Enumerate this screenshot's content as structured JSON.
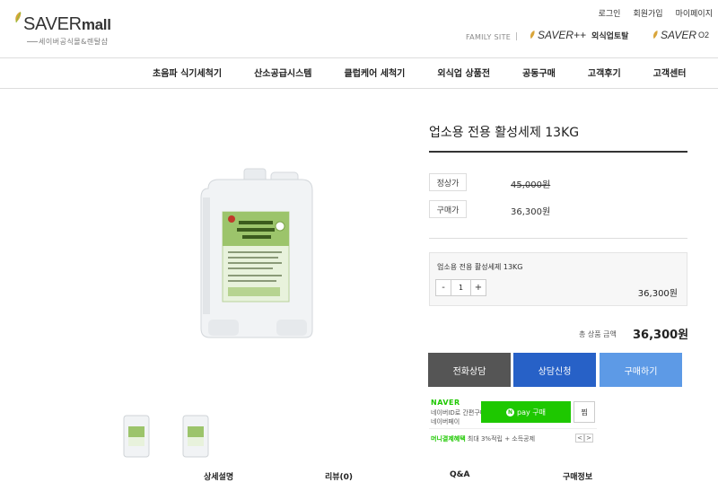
{
  "brand": {
    "logo_text": "SAVER",
    "logo_mall": "mall",
    "subtitle": "세이버공식몰&렌탈샵",
    "leaf_color": "#d9a53a",
    "leaf_color_2": "#8bbf3a"
  },
  "top_links": [
    "로그인",
    "회원가입",
    "마이페이지"
  ],
  "family": {
    "label": "FAMILY SITE",
    "separator": "|",
    "site1_name": "SAVER++",
    "site1_tag": "외식업토탈",
    "site2_name": "SAVER",
    "site2_tag": "O2"
  },
  "nav": [
    "초음파 식기세척기",
    "산소공급시스템",
    "클럽케어 세척기",
    "외식업 상품전",
    "공동구매",
    "고객후기",
    "고객센터"
  ],
  "product": {
    "title": "업소용 전용 활성세제 13KG",
    "list_price_label": "정상가",
    "list_price": "45,000원",
    "sale_price_label": "구매가",
    "sale_price": "36,300원",
    "option_name": "업소용 전용 활성세제 13KG",
    "qty_minus": "-",
    "qty_value": "1",
    "qty_plus": "+",
    "option_price": "36,300원",
    "total_label": "총 상품 금액",
    "total_price": "36,300원",
    "thumbnail_count": 2
  },
  "buttons": {
    "phone": "전화상담",
    "consult": "상담신청",
    "buy": "구매하기",
    "phone_color": "#555555",
    "consult_color": "#2761c7",
    "buy_color": "#5d9ae6"
  },
  "naverpay": {
    "logo": "NAVER",
    "line1": "네이버ID로 간편구매",
    "line2": "네이버페이",
    "pay_badge": "N",
    "pay_label": "pay 구매",
    "zzim": "찜",
    "benefit_label": "머니결제혜택",
    "benefit_text": "최대 3%적립 + 소득공제",
    "prev": "<",
    "next": ">",
    "color": "#1ec800"
  },
  "tabs": [
    "상세설명",
    "리뷰(0)",
    "Q&A",
    "구매정보"
  ]
}
